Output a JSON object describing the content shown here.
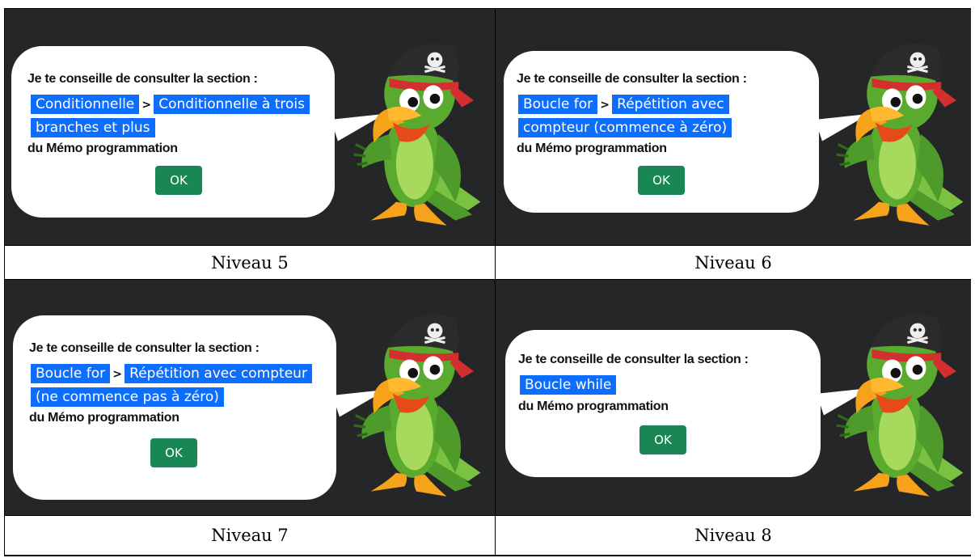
{
  "panels": [
    {
      "message": "Je te conseille de consulter la section :",
      "crumb_first": "Conditionnelle",
      "crumb_sep": ">",
      "crumb_second": "Conditionnelle à trois branches et plus",
      "footer": "du Mémo programmation",
      "ok_label": "OK",
      "caption": "Niveau 5"
    },
    {
      "message": "Je te conseille de consulter la section :",
      "crumb_first": "Boucle for",
      "crumb_sep": ">",
      "crumb_second": "Répétition avec compteur (commence à zéro)",
      "footer": "du Mémo programmation",
      "ok_label": "OK",
      "caption": "Niveau 6"
    },
    {
      "message": "Je te conseille de consulter la section :",
      "crumb_first": "Boucle for",
      "crumb_sep": ">",
      "crumb_second": "Répétition avec compteur (ne commence pas à zéro)",
      "footer": "du Mémo programmation",
      "ok_label": "OK",
      "caption": "Niveau 7"
    },
    {
      "message": "Je te conseille de consulter la section :",
      "crumb_first": "Boucle while",
      "footer": "du Mémo programmation",
      "ok_label": "OK",
      "caption": "Niveau 8"
    }
  ],
  "colors": {
    "background": "#252628",
    "highlight": "#0d6efd",
    "ok_button": "#198754"
  },
  "icons": [
    "pirate-parrot-mascot",
    "skull-crossbones-icon"
  ]
}
